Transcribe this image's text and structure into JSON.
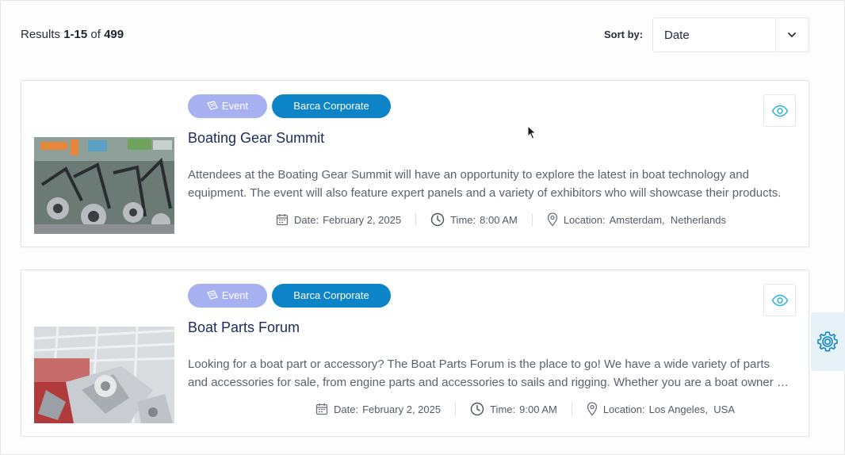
{
  "results": {
    "prefix": "Results",
    "range": "1-15",
    "of": "of",
    "total": "499"
  },
  "sort": {
    "label": "Sort by:",
    "value": "Date"
  },
  "colors": {
    "event_tag": "#a7b1f2",
    "corp_tag": "#0e84c8",
    "title": "#1d2a5c",
    "eye": "#2bb3d6"
  },
  "cards": [
    {
      "tag_event": "Event",
      "tag_org": "Barca Corporate",
      "title": "Boating Gear Summit",
      "description": "Attendees at the Boating Gear Summit will have an opportunity to explore the latest in boat technology and equipment. The event will also feature expert panels and a variety of exhibitors who will showcase their products.",
      "date_label": "Date:",
      "date": "February 2, 2025",
      "time_label": "Time:",
      "time": "8:00 AM",
      "location_label": "Location:",
      "location": "Amsterdam,  Netherlands",
      "thumb": "boating-gear-photo"
    },
    {
      "tag_event": "Event",
      "tag_org": "Barca Corporate",
      "title": "Boat Parts Forum",
      "description": "Looking for a boat part or accessory? The Boat Parts Forum is the place to go! We have a wide variety of parts and accessories for sale, from engine parts and accessories to sails and rigging. Whether you are a boat owner or a dealer.",
      "date_label": "Date:",
      "date": "February 2, 2025",
      "time_label": "Time:",
      "time": "9:00 AM",
      "location_label": "Location:",
      "location": "Los Angeles,  USA",
      "thumb": "boat-parts-photo"
    }
  ],
  "icons": {
    "calendar": "calendar-icon",
    "clock": "clock-icon",
    "pin": "location-pin-icon",
    "eye": "eye-icon",
    "gear": "gear-icon",
    "chevron": "chevron-down-icon",
    "cursor": "mouse-cursor-icon"
  }
}
